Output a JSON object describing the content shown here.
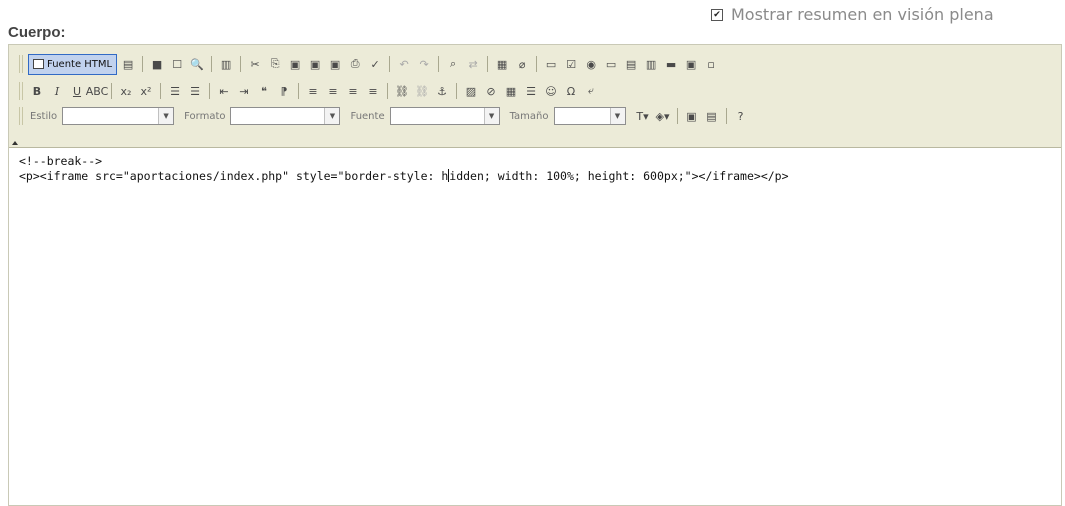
{
  "checkbox": {
    "label": "Mostrar resumen en visión plena",
    "checked": true
  },
  "field_label": "Cuerpo:",
  "toolbar": {
    "source_button_label": "Fuente HTML",
    "row1": [
      {
        "name": "preview-icon",
        "glyph": "▤"
      },
      {
        "sep": true
      },
      {
        "name": "save-icon",
        "glyph": "■"
      },
      {
        "name": "new-page-icon",
        "glyph": "☐"
      },
      {
        "name": "print-preview-icon",
        "glyph": "🔍"
      },
      {
        "sep": true
      },
      {
        "name": "templates-icon",
        "glyph": "▥"
      },
      {
        "sep": true
      },
      {
        "name": "cut-icon",
        "glyph": "✂"
      },
      {
        "name": "copy-icon",
        "glyph": "⎘"
      },
      {
        "name": "paste-icon",
        "glyph": "▣"
      },
      {
        "name": "paste-text-icon",
        "glyph": "▣"
      },
      {
        "name": "paste-word-icon",
        "glyph": "▣"
      },
      {
        "name": "print-icon",
        "glyph": "⎙"
      },
      {
        "name": "spellcheck-icon",
        "glyph": "✓"
      },
      {
        "sep": true
      },
      {
        "name": "undo-icon",
        "glyph": "↶",
        "light": true
      },
      {
        "name": "redo-icon",
        "glyph": "↷",
        "light": true
      },
      {
        "sep": true
      },
      {
        "name": "find-icon",
        "glyph": "⌕"
      },
      {
        "name": "replace-icon",
        "glyph": "⇄",
        "light": true
      },
      {
        "sep": true
      },
      {
        "name": "select-all-icon",
        "glyph": "▦"
      },
      {
        "name": "remove-format-icon",
        "glyph": "⌀"
      },
      {
        "sep": true
      },
      {
        "name": "form-icon",
        "glyph": "▭"
      },
      {
        "name": "checkbox-icon",
        "glyph": "☑"
      },
      {
        "name": "radio-icon",
        "glyph": "◉"
      },
      {
        "name": "textfield-icon",
        "glyph": "▭"
      },
      {
        "name": "textarea-icon",
        "glyph": "▤"
      },
      {
        "name": "select-icon",
        "glyph": "▥"
      },
      {
        "name": "button-icon",
        "glyph": "▬"
      },
      {
        "name": "image-button-icon",
        "glyph": "▣"
      },
      {
        "name": "hidden-field-icon",
        "glyph": "▫"
      }
    ],
    "row2": [
      {
        "name": "bold-icon",
        "glyph": "B",
        "cls": "bold"
      },
      {
        "name": "italic-icon",
        "glyph": "I",
        "cls": "ital"
      },
      {
        "name": "underline-icon",
        "glyph": "U",
        "cls": "und"
      },
      {
        "name": "strike-icon",
        "glyph": "ABC"
      },
      {
        "sep": true
      },
      {
        "name": "subscript-icon",
        "glyph": "x₂"
      },
      {
        "name": "superscript-icon",
        "glyph": "x²"
      },
      {
        "sep": true
      },
      {
        "name": "numbered-list-icon",
        "glyph": "☰"
      },
      {
        "name": "bulleted-list-icon",
        "glyph": "☰"
      },
      {
        "sep": true
      },
      {
        "name": "outdent-icon",
        "glyph": "⇤"
      },
      {
        "name": "indent-icon",
        "glyph": "⇥"
      },
      {
        "name": "blockquote-icon",
        "glyph": "❝"
      },
      {
        "name": "div-icon",
        "glyph": "⁋"
      },
      {
        "sep": true
      },
      {
        "name": "align-left-icon",
        "glyph": "≡"
      },
      {
        "name": "align-center-icon",
        "glyph": "≡"
      },
      {
        "name": "align-right-icon",
        "glyph": "≡"
      },
      {
        "name": "justify-icon",
        "glyph": "≡"
      },
      {
        "sep": true
      },
      {
        "name": "link-icon",
        "glyph": "⛓"
      },
      {
        "name": "unlink-icon",
        "glyph": "⛓",
        "light": true
      },
      {
        "name": "anchor-icon",
        "glyph": "⚓"
      },
      {
        "sep": true
      },
      {
        "name": "image-icon",
        "glyph": "▨"
      },
      {
        "name": "flash-icon",
        "glyph": "⊘"
      },
      {
        "name": "table-icon",
        "glyph": "▦"
      },
      {
        "name": "horizontal-rule-icon",
        "glyph": "☰"
      },
      {
        "name": "smiley-icon",
        "glyph": "☺"
      },
      {
        "name": "special-char-icon",
        "glyph": "Ω"
      },
      {
        "name": "page-break-icon",
        "glyph": "⤶"
      }
    ],
    "row3_fields": {
      "style_label": "Estilo",
      "format_label": "Formato",
      "font_label": "Fuente",
      "size_label": "Tamaño"
    },
    "row3_tail": [
      {
        "name": "text-color-icon",
        "glyph": "T▾"
      },
      {
        "name": "background-color-icon",
        "glyph": "◈▾"
      },
      {
        "sep": true
      },
      {
        "name": "maximize-icon",
        "glyph": "▣"
      },
      {
        "name": "show-blocks-icon",
        "glyph": "▤"
      },
      {
        "sep": true
      },
      {
        "name": "about-icon",
        "glyph": "?"
      }
    ]
  },
  "editor": {
    "line1": "<!--break-->",
    "line2_before_caret": "<p><iframe src=\"aportaciones/index.php\" style=\"border-style: h",
    "line2_after_caret": "idden; width: 100%; height: 600px;\"></iframe></p>"
  }
}
